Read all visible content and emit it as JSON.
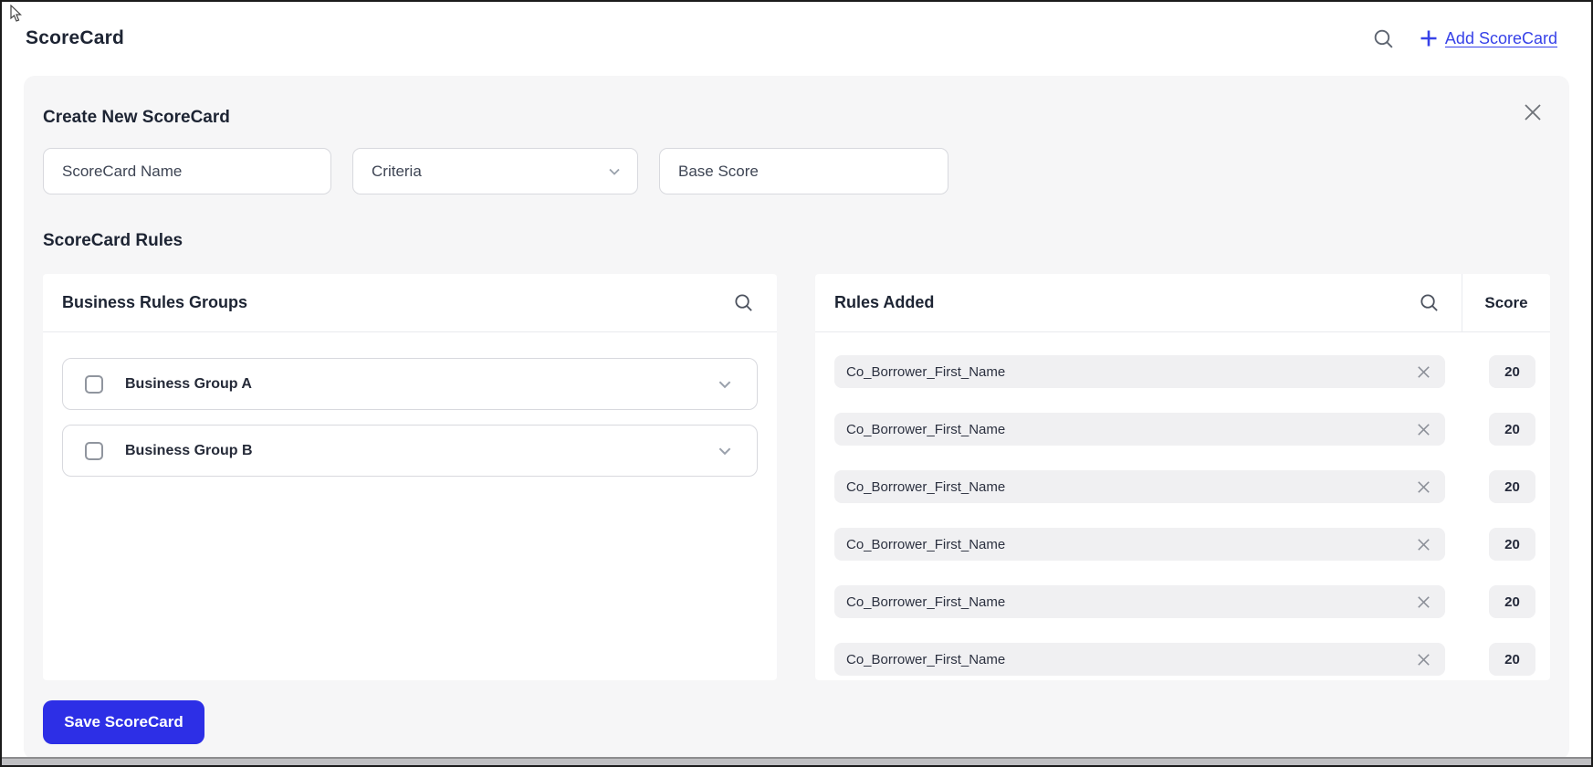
{
  "header": {
    "title": "ScoreCard",
    "add_link": "Add ScoreCard"
  },
  "panel": {
    "title": "Create New ScoreCard",
    "fields": {
      "name_placeholder": "ScoreCard Name",
      "criteria_placeholder": "Criteria",
      "base_placeholder": "Base Score"
    },
    "rules_heading": "ScoreCard Rules",
    "groups_panel": {
      "title": "Business Rules Groups",
      "groups": [
        {
          "label": "Business Group A",
          "checked": false
        },
        {
          "label": "Business Group B",
          "checked": false
        }
      ]
    },
    "rules_panel": {
      "title": "Rules Added",
      "score_header": "Score",
      "rules": [
        {
          "name": "Co_Borrower_First_Name",
          "score": "20"
        },
        {
          "name": "Co_Borrower_First_Name",
          "score": "20"
        },
        {
          "name": "Co_Borrower_First_Name",
          "score": "20"
        },
        {
          "name": "Co_Borrower_First_Name",
          "score": "20"
        },
        {
          "name": "Co_Borrower_First_Name",
          "score": "20"
        },
        {
          "name": "Co_Borrower_First_Name",
          "score": "20"
        }
      ]
    },
    "save_label": "Save ScoreCard"
  },
  "colors": {
    "link_blue": "#3742e8",
    "save_blue": "#2d2fe6",
    "panel_bg": "#f6f6f7",
    "pill_bg": "#f0f0f2",
    "heading_text": "#1d2433"
  }
}
